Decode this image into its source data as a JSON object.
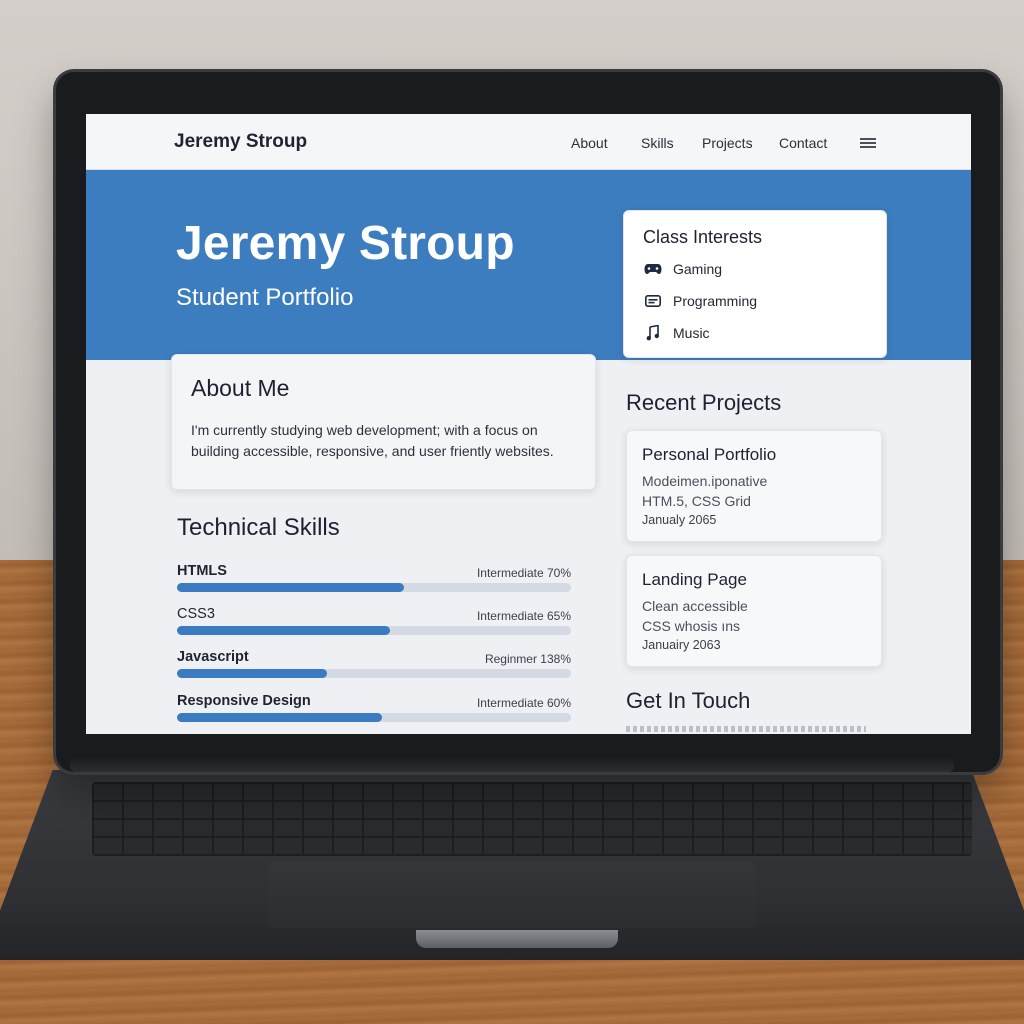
{
  "nav": {
    "brand": "Jeremy Stroup",
    "links": [
      "About",
      "Skills",
      "Projects",
      "Contact"
    ],
    "menu_icon": "hamburger-menu-icon"
  },
  "hero": {
    "title": "Jeremy Stroup",
    "subtitle": "Student Portfolio",
    "background_color": "#3c7dbf"
  },
  "interests": {
    "title": "Class Interests",
    "items": [
      {
        "icon": "gamepad-icon",
        "label": "Gaming"
      },
      {
        "icon": "keyboard-icon",
        "label": "Programming"
      },
      {
        "icon": "music-note-icon",
        "label": "Music"
      }
    ]
  },
  "about": {
    "title": "About Me",
    "text": "I'm currently studying web development; with a focus on building accessible, responsive, and user friently websites."
  },
  "skills": {
    "title": "Technical Skills",
    "items": [
      {
        "name": "HTMLS",
        "level": "Intermediate 70%",
        "fraction": 0.575
      },
      {
        "name": "CSS3",
        "level": "Intermediate 65%",
        "fraction": 0.54
      },
      {
        "name": "Javascript",
        "level": "Reginmer 138%",
        "fraction": 0.38
      },
      {
        "name": "Responsive Design",
        "level": "Intermediate 60%",
        "fraction": 0.52
      }
    ],
    "bar_color": "#3a7bc2"
  },
  "projects": {
    "title": "Recent Projects",
    "items": [
      {
        "title": "Personal Portfolio",
        "line1": "Modeimen.iponative",
        "line2": "HTM.5, CSS Grid",
        "date": "Janualy 2065"
      },
      {
        "title": "Landing Page",
        "line1": "Clean accessible",
        "line2": "CSS whosis ıns",
        "date": "Januairy 2063"
      }
    ]
  },
  "contact": {
    "title": "Get In Touch"
  }
}
